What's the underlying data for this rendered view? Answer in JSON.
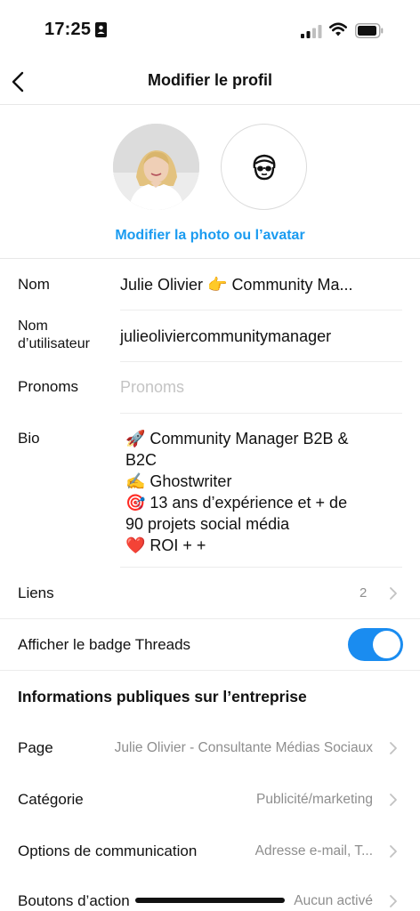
{
  "status_bar": {
    "time": "17:25",
    "icons": [
      "id-card-icon",
      "signal-icon",
      "wifi-icon",
      "battery-icon"
    ]
  },
  "header": {
    "title": "Modifier le profil",
    "back_icon": "chevron-left-icon"
  },
  "avatar_section": {
    "edit_link": "Modifier la photo ou l’avatar",
    "accent_color": "#1a9bf0"
  },
  "fields": {
    "name": {
      "label": "Nom",
      "value": "Julie Olivier 👉 Community Ma..."
    },
    "username": {
      "label_line1": "Nom",
      "label_line2": "d’utilisateur",
      "value": "julieoliviercommunitymanager"
    },
    "pronouns": {
      "label": "Pronoms",
      "placeholder": "Pronoms"
    },
    "bio": {
      "label": "Bio",
      "lines": [
        "🚀 Community Manager B2B &",
        "B2C",
        "✍️ Ghostwriter",
        "🎯 13 ans d’expérience et + de",
        "90 projets social média",
        "❤️ ROI + +"
      ]
    },
    "links": {
      "label": "Liens",
      "count": "2"
    }
  },
  "threads_badge": {
    "label": "Afficher le badge Threads",
    "enabled": true,
    "toggle_color": "#1a8cf0"
  },
  "business_info": {
    "title": "Informations publiques sur l’entreprise",
    "rows": [
      {
        "label": "Page",
        "value": "Julie Olivier - Consultante Médias Sociaux"
      },
      {
        "label": "Catégorie",
        "value": "Publicité/marketing"
      },
      {
        "label": "Options de communication",
        "value": "Adresse e-mail, T..."
      },
      {
        "label": "Boutons d’action",
        "value": "Aucun activé"
      }
    ]
  }
}
